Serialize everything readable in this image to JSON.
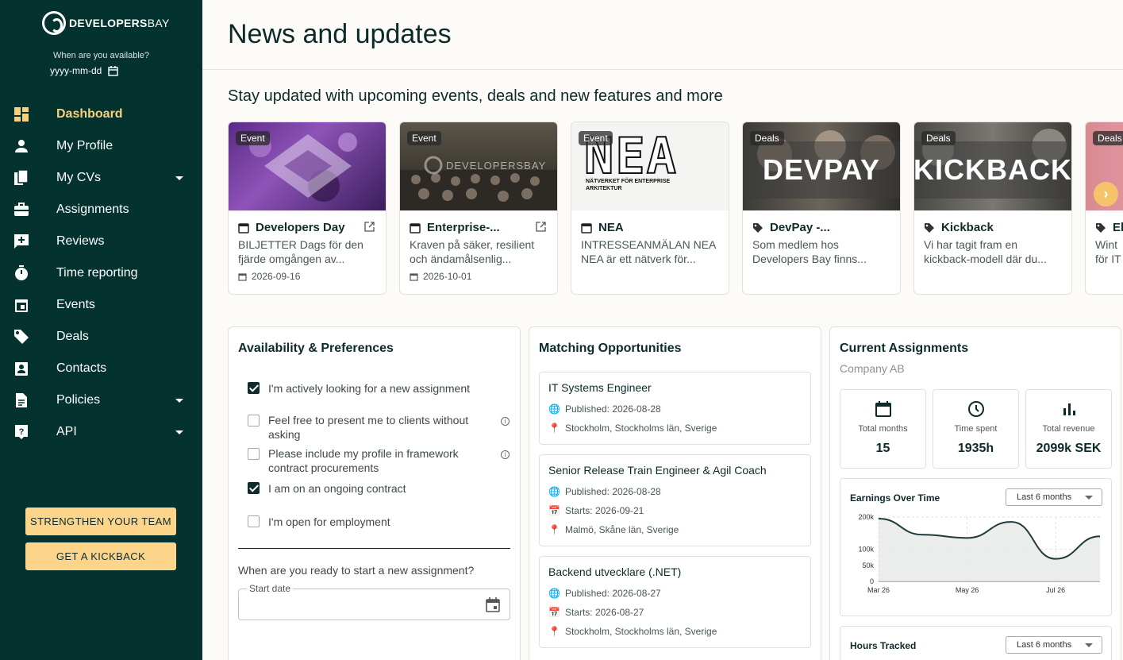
{
  "brand": {
    "strong": "DEVELOPERS",
    "light": "BAY"
  },
  "availability": {
    "label": "When are you available?",
    "date_placeholder": "yyyy-mm-dd"
  },
  "nav": [
    {
      "label": "Dashboard",
      "icon": "dashboard-icon",
      "active": true,
      "caret": false
    },
    {
      "label": "My Profile",
      "icon": "person-icon",
      "active": false,
      "caret": false
    },
    {
      "label": "My CVs",
      "icon": "documents-icon",
      "active": false,
      "caret": true
    },
    {
      "label": "Assignments",
      "icon": "briefcase-icon",
      "active": false,
      "caret": false
    },
    {
      "label": "Reviews",
      "icon": "review-icon",
      "active": false,
      "caret": false
    },
    {
      "label": "Time reporting",
      "icon": "timer-icon",
      "active": false,
      "caret": false
    },
    {
      "label": "Events",
      "icon": "calendar-icon",
      "active": false,
      "caret": false
    },
    {
      "label": "Deals",
      "icon": "tag-icon",
      "active": false,
      "caret": false
    },
    {
      "label": "Contacts",
      "icon": "contact-icon",
      "active": false,
      "caret": false
    },
    {
      "label": "Policies",
      "icon": "policy-icon",
      "active": false,
      "caret": true
    },
    {
      "label": "API",
      "icon": "help-icon",
      "active": false,
      "caret": true
    }
  ],
  "buttons": {
    "team": "STRENGTHEN YOUR TEAM",
    "kickback": "GET A KICKBACK"
  },
  "header": {
    "title": "News and updates"
  },
  "news": {
    "subtitle": "Stay updated with upcoming events, deals and new features and more",
    "cards": [
      {
        "tag": "Event",
        "title": "Developers Day",
        "desc": "BILJETTER Dags för den fjärde omgången av...",
        "date": "2026-09-16"
      },
      {
        "tag": "Event",
        "title": "Enterprise-...",
        "desc": "Kraven på säker, resilient och ändamålsenlig...",
        "date": "2026-10-01"
      },
      {
        "tag": "Event",
        "title": "NEA",
        "desc": "INTRESSEANMÄLAN NEA NEA är ett nätverk för...",
        "logo": "NEA",
        "logo_sub": "NÄTVERKET FÖR ENTERPRISE ARKITEKTUR"
      },
      {
        "tag": "Deals",
        "title": "DevPay -...",
        "desc": "Som medlem hos Developers Bay finns...",
        "banner": "DEVPAY"
      },
      {
        "tag": "Deals",
        "title": "Kickback",
        "desc": "Vi har tagit fram en kickback-modell där du...",
        "banner": "KICKBACK"
      },
      {
        "tag": "Deals",
        "title": "El",
        "desc": "Wint för IT"
      }
    ],
    "watermark": "DEVELOPERSBAY"
  },
  "availability_panel": {
    "title": "Availability & Preferences",
    "options": [
      {
        "label": "I'm actively looking for a new assignment",
        "checked": true,
        "info": false
      },
      {
        "label": "Feel free to present me to clients without asking",
        "checked": false,
        "info": true
      },
      {
        "label": "Please include my profile in framework contract procurements",
        "checked": false,
        "info": true
      },
      {
        "label": "I am on an ongoing contract",
        "checked": true,
        "info": false
      },
      {
        "label": "I'm open for employment",
        "checked": false,
        "info": false
      }
    ],
    "ready_label": "When are you ready to start a new assignment?",
    "start_label": "Start date"
  },
  "matching": {
    "title": "Matching Opportunities",
    "items": [
      {
        "title": "IT Systems Engineer",
        "published": "Published: 2026-08-28",
        "location": "Stockholm, Stockholms län, Sverige"
      },
      {
        "title": "Senior Release Train Engineer & Agil Coach",
        "published": "Published: 2026-08-28",
        "starts": "Starts: 2026-09-21",
        "location": "Malmö, Skåne län, Sverige"
      },
      {
        "title": "Backend utvecklare (.NET)",
        "published": "Published: 2026-08-27",
        "starts": "Starts: 2026-08-27",
        "location": "Stockholm, Stockholms län, Sverige"
      }
    ]
  },
  "assignments": {
    "title": "Current Assignments",
    "company": "Company AB",
    "stats": [
      {
        "label": "Total months",
        "value": "15",
        "icon": "calendar-icon"
      },
      {
        "label": "Time spent",
        "value": "1935h",
        "icon": "clock-icon"
      },
      {
        "label": "Total revenue",
        "value": "2099k SEK",
        "icon": "bar-chart-icon"
      }
    ],
    "earnings_title": "Earnings Over Time",
    "earnings_range": "Last 6 months",
    "hours_title": "Hours Tracked",
    "hours_range": "Last 6 months"
  },
  "chart_data": {
    "type": "area",
    "title": "Earnings Over Time",
    "x": [
      "Mar 26",
      "Apr 26",
      "May 26",
      "Jun 26",
      "Jul 26",
      "Aug 26"
    ],
    "x_ticks": [
      "Mar 26",
      "May 26",
      "Jul 26"
    ],
    "y_ticks": [
      "0",
      "50k",
      "100k",
      "200k"
    ],
    "values": [
      195000,
      145000,
      135000,
      185000,
      70000,
      140000
    ],
    "ylim": [
      0,
      200000
    ],
    "grid": true,
    "colors": {
      "line": "#1e3a3a",
      "fill": "#e6e8e8"
    }
  }
}
